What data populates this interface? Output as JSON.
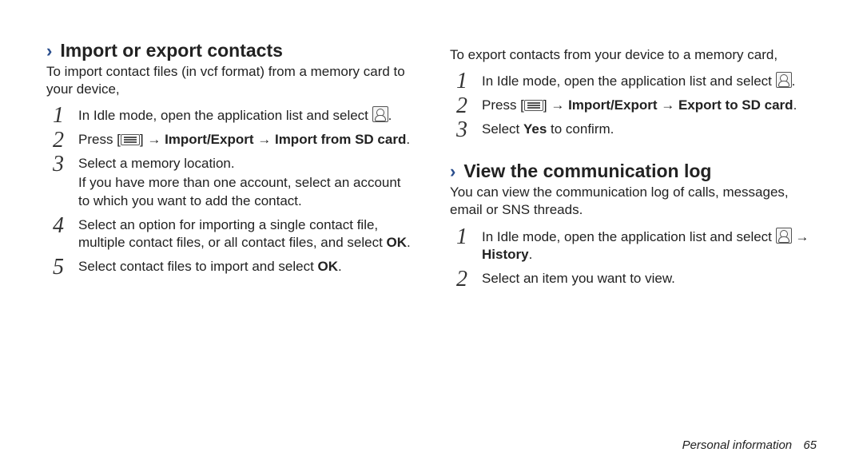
{
  "left": {
    "section1": {
      "title": "Import or export contacts",
      "intro": "To import contact files (in vcf format) from a memory card to your device,",
      "step1_a": "In Idle mode, open the application list and select ",
      "step1_c": ".",
      "step2_a": "Press [",
      "step2_b": "] → ",
      "step2_bold": "Import/Export → Import from SD card",
      "step2_c": ".",
      "step3": "Select a memory location.",
      "step3_sub": "If you have more than one account, select an account to which you want to add the contact.",
      "step4_a": "Select an option for importing a single contact file, multiple contact files, or all contact files, and select ",
      "step4_bold": "OK",
      "step4_c": ".",
      "step5_a": "Select contact files to import and select ",
      "step5_bold": "OK",
      "step5_c": "."
    }
  },
  "right": {
    "export": {
      "intro": "To export contacts from your device to a memory card,",
      "step1_a": "In Idle mode, open the application list and select ",
      "step1_c": ".",
      "step2_a": "Press [",
      "step2_b": "] → ",
      "step2_bold": "Import/Export → Export to SD card",
      "step2_c": ".",
      "step3_a": "Select ",
      "step3_bold": "Yes",
      "step3_b": " to confirm."
    },
    "section2": {
      "title": "View the communication log",
      "intro": "You can view the communication log of calls, messages, email or SNS threads.",
      "step1_a": "In Idle mode, open the application list and select ",
      "step1_b": " → ",
      "step1_bold": "History",
      "step1_c": ".",
      "step2": "Select an item you want to view."
    }
  },
  "footer": {
    "label": "Personal information",
    "page": "65"
  }
}
